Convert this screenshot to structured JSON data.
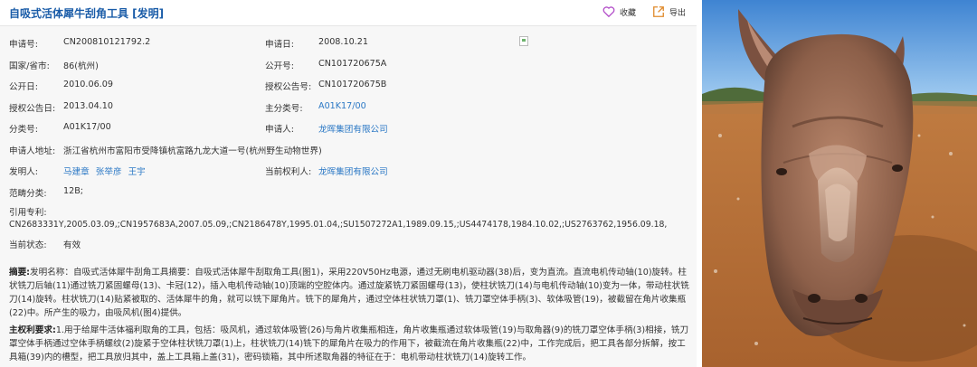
{
  "header": {
    "title": "自吸式活体犀牛刮角工具 [发明]",
    "favorite_label": "收藏",
    "export_label": "导出"
  },
  "fields": {
    "application_no": {
      "label": "申请号:",
      "value": "CN200810121792.2"
    },
    "application_date": {
      "label": "申请日:",
      "value": "2008.10.21"
    },
    "country": {
      "label": "国家/省市:",
      "value": "86(杭州)"
    },
    "publication_no": {
      "label": "公开号:",
      "value": "CN101720675A"
    },
    "publication_date": {
      "label": "公开日:",
      "value": "2010.06.09"
    },
    "grant_no": {
      "label": "授权公告号:",
      "value": "CN101720675B"
    },
    "grant_date": {
      "label": "授权公告日:",
      "value": "2013.04.10"
    },
    "main_class": {
      "label": "主分类号:",
      "value": "A01K17/00"
    },
    "sub_class": {
      "label": "分类号:",
      "value": "A01K17/00"
    },
    "applicant": {
      "label": "申请人:",
      "value": "龙晖集团有限公司"
    },
    "address": {
      "label": "申请人地址:",
      "value": "浙江省杭州市富阳市受降镇杭富路九龙大道一号(杭州野生动物世界)"
    },
    "inventors": {
      "label": "发明人:",
      "values": [
        "马建章",
        "张举彦",
        "王宇"
      ]
    },
    "current_holder": {
      "label": "当前权利人:",
      "value": "龙晖集团有限公司"
    },
    "scope": {
      "label": "范畴分类:",
      "value": "12B;"
    },
    "citations": {
      "label": "引用专利:",
      "value": "CN2683331Y,2005.03.09,;CN1957683A,2007.05.09,;CN2186478Y,1995.01.04,;SU1507272A1,1989.09.15,;US4474178,1984.10.02,;US2763762,1956.09.18,"
    },
    "status": {
      "label": "当前状态:",
      "value": "有效"
    }
  },
  "abstract": {
    "label": "摘要:",
    "text": "发明名称：自吸式活体犀牛刮角工具摘要：自吸式活体犀牛刮取角工具(图1)，采用220V50Hz电源，通过无刷电机驱动器(38)后，变为直流。直流电机传动轴(10)旋转。柱状铣刀后轴(11)通过铣刀紧固螺母(13)、卡冠(12)，插入电机传动轴(10)顶端的空腔体内。通过旋紧铣刀紧固螺母(13)，使柱状铣刀(14)与电机传动轴(10)变为一体，带动柱状铣刀(14)旋转。柱状铣刀(14)贴紧被取的、活体犀牛的角，就可以铣下犀角片。铣下的犀角片，通过空体柱状铣刀罩(1)、铣刀罩空体手柄(3)、软体吸管(19)，被截留在角片收集瓶(22)中。所产生的吸力，由吸风机(图4)提供。"
  },
  "claims": {
    "label": "主权利要求:",
    "text": "1.用于给犀牛活体福利取角的工具，包括：吸风机，通过软体吸管(26)与角片收集瓶相连，角片收集瓶通过软体吸管(19)与取角器(9)的铣刀罩空体手柄(3)相接，铣刀罩空体手柄通过空体手柄螺纹(2)旋紧于空体柱状铣刀罩(1)上，柱状铣刀(14)铣下的犀角片在吸力的作用下，被截流在角片收集瓶(22)中，工作完成后，把工具各部分拆解，按工具箱(39)内的槽型，把工具放归其中，盖上工具箱上盖(31)，密码锁箱，其中所述取角器的特征在于：电机带动柱状铣刀(14)旋转工作。"
  },
  "photo": {
    "subject": "rhinoceros-photo"
  }
}
